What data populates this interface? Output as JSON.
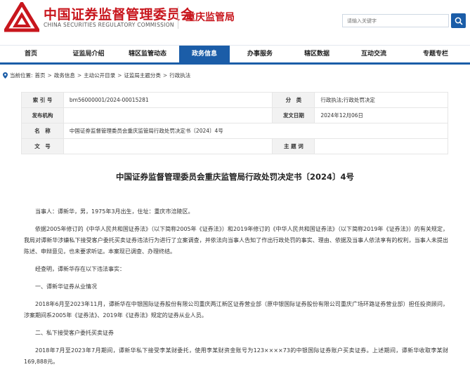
{
  "header": {
    "org_name_cn": "中国证券监督管理委员会",
    "org_name_en": "CHINA SECURITIES REGULATORY COMMISSION",
    "bureau_name": "重庆监管局",
    "search_placeholder": "请输入关键字",
    "brand_color": "#c8161d"
  },
  "nav": {
    "items": [
      {
        "label": "首页"
      },
      {
        "label": "证监局介绍"
      },
      {
        "label": "辖区监管动态"
      },
      {
        "label": "政务信息"
      },
      {
        "label": "办事服务"
      },
      {
        "label": "辖区数据"
      },
      {
        "label": "互动交流"
      },
      {
        "label": "专题专栏"
      }
    ],
    "active_index": 3,
    "accent_color": "#1b5da8"
  },
  "breadcrumb": {
    "prefix": "当前位置:",
    "items": [
      "首页",
      "政务信息",
      "主动公开目录",
      "证监局主题分类",
      "行政执法"
    ],
    "separator": ">"
  },
  "meta": {
    "index_label": "索 引 号",
    "index_value": "bm56000001/2024-00015281",
    "category_label": "分　类",
    "category_value": "行政执法;行政处罚决定",
    "issuer_label": "发布机构",
    "issuer_value": "",
    "date_label": "发文日期",
    "date_value": "2024年12月06日",
    "name_label": "名　称",
    "name_value": "中国证券监督管理委员会重庆监管局行政处罚决定书〔2024〕4号",
    "docno_label": "文　号",
    "docno_value": "",
    "subject_label": "主 题 词",
    "subject_value": ""
  },
  "document": {
    "title": "中国证券监督管理委员会重庆监管局行政处罚决定书〔2024〕4号",
    "paragraphs": [
      "当事人：谭新华，男，1975年3月出生，住址：重庆市涪陵区。",
      "依据2005年修订的《中华人民共和国证券法》（以下简称2005年《证券法》）和2019年修订的《中华人民共和国证券法》（以下简称2019年《证券法》）的有关规定，我局对谭新华涉嫌私下接受客户委托买卖证券违法行为进行了立案调查，并依法向当事人告知了作出行政处罚的事实、理由、依据及当事人依法享有的权利，当事人未提出陈述、申辩意见，也未要求听证。本案现已调查、办理终结。",
      "经查明，谭新华存在以下违法事实：",
      "一、谭新华证券从业情况",
      "2018年6月至2023年11月，谭新华在中银国际证券股份有限公司重庆两江新区证券营业部（原中银国际证券股份有限公司重庆广场环路证券营业部）担任投资顾问，涉案期间系2005年《证券法》、2019年《证券法》规定的证券从业人员。",
      "二、私下接受客户委托买卖证券",
      "2018年7月至2023年7月期间，谭新华私下接受李某财委托，使用李某财资金账号为123××××73的中银国际证券账户买卖证券。上述期间，谭新华收取李某财169,888元。"
    ]
  }
}
